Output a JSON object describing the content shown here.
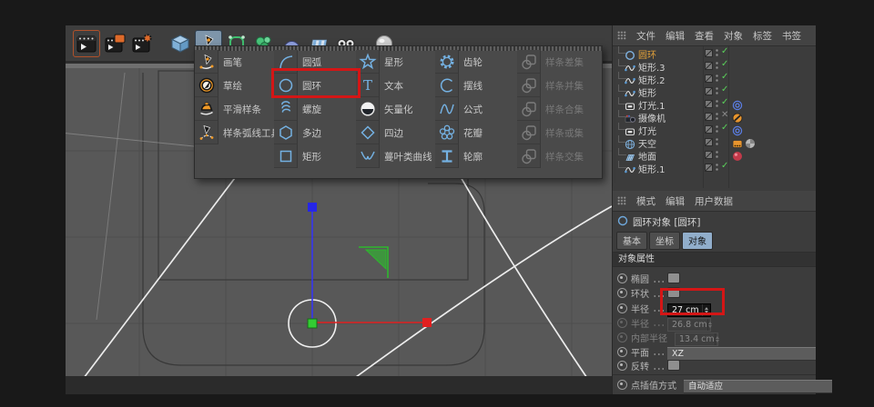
{
  "colors": {
    "annotation": "#d41616",
    "popup_icon_blue": "#74b1e2",
    "check_green": "#5ad05a",
    "selected_object_text": "#e2a13a",
    "tab_active_bg": "#91aecb",
    "axis_red": "#e02020",
    "axis_blue": "#3535f0",
    "plane_handle_green": "#2db82d"
  },
  "toolbar": {
    "buttons": [
      {
        "icon": "render-view",
        "active": true
      },
      {
        "icon": "render-picture-viewer",
        "active": false
      },
      {
        "icon": "render-settings",
        "active": false
      },
      {
        "icon": "primitive-cube",
        "active": false
      },
      {
        "icon": "spline-pen",
        "active": true
      },
      {
        "icon": "subdivision-surface",
        "active": false
      },
      {
        "icon": "modeling",
        "active": false
      },
      {
        "icon": "volume",
        "active": false
      },
      {
        "icon": "field",
        "active": false
      },
      {
        "icon": "mograph",
        "active": false
      },
      {
        "icon": "material-sphere",
        "active": false
      }
    ]
  },
  "spline_menu": {
    "tools": [
      {
        "label": "画笔",
        "icon": "tool-pen"
      },
      {
        "label": "草绘",
        "icon": "tool-sketch"
      },
      {
        "label": "平滑样条",
        "icon": "tool-smooth"
      },
      {
        "label": "样条弧线工具",
        "icon": "tool-spline-arc"
      }
    ],
    "columns": [
      {
        "items": [
          {
            "label": "圆弧",
            "icon": "arc"
          },
          {
            "label": "圆环",
            "icon": "circle",
            "highlighted": true
          },
          {
            "label": "螺旋",
            "icon": "helix"
          },
          {
            "label": "多边",
            "icon": "ngon"
          },
          {
            "label": "矩形",
            "icon": "rectangle"
          }
        ]
      },
      {
        "items": [
          {
            "label": "星形",
            "icon": "star"
          },
          {
            "label": "文本",
            "icon": "text"
          },
          {
            "label": "矢量化",
            "icon": "vectorizer"
          },
          {
            "label": "四边",
            "icon": "foursided"
          },
          {
            "label": "蔓叶类曲线",
            "icon": "cissoid"
          }
        ]
      },
      {
        "items": [
          {
            "label": "齿轮",
            "icon": "gear"
          },
          {
            "label": "摆线",
            "icon": "cycloid"
          },
          {
            "label": "公式",
            "icon": "formula"
          },
          {
            "label": "花瓣",
            "icon": "flower"
          },
          {
            "label": "轮廓",
            "icon": "profile"
          }
        ]
      },
      {
        "items": [
          {
            "label": "样条差集",
            "icon": "spline-difference",
            "disabled": true
          },
          {
            "label": "样条并集",
            "icon": "spline-union",
            "disabled": true
          },
          {
            "label": "样条合集",
            "icon": "spline-and",
            "disabled": true
          },
          {
            "label": "样条或集",
            "icon": "spline-or",
            "disabled": true
          },
          {
            "label": "样条交集",
            "icon": "spline-intersect",
            "disabled": true
          }
        ]
      }
    ]
  },
  "object_manager": {
    "menu": [
      "文件",
      "编辑",
      "查看",
      "对象",
      "标签",
      "书签"
    ],
    "objects": [
      {
        "name": "圆环",
        "icon": "circle-spline",
        "selected": true,
        "state": "check",
        "tags": []
      },
      {
        "name": "矩形.3",
        "icon": "spline",
        "selected": false,
        "state": "check",
        "tags": []
      },
      {
        "name": "矩形.2",
        "icon": "spline",
        "selected": false,
        "state": "check",
        "tags": []
      },
      {
        "name": "矩形",
        "icon": "spline",
        "selected": false,
        "state": "check",
        "tags": []
      },
      {
        "name": "灯光.1",
        "icon": "light",
        "selected": false,
        "state": "check",
        "tags": [
          "target"
        ]
      },
      {
        "name": "摄像机",
        "icon": "camera",
        "selected": false,
        "state": "cross",
        "tags": [
          "protection"
        ]
      },
      {
        "name": "灯光",
        "icon": "light",
        "selected": false,
        "state": "check",
        "tags": [
          "target"
        ]
      },
      {
        "name": "天空",
        "icon": "sky",
        "selected": false,
        "state": "none",
        "tags": [
          "compositing",
          "texture"
        ]
      },
      {
        "name": "地面",
        "icon": "floor",
        "selected": false,
        "state": "none",
        "tags": [
          "material"
        ]
      },
      {
        "name": "矩形.1",
        "icon": "spline",
        "selected": false,
        "state": "check",
        "tags": []
      }
    ]
  },
  "attribute_manager": {
    "menu": [
      "模式",
      "编辑",
      "用户数据"
    ],
    "object_icon": "circle-spline",
    "title": "圆环对象 [圆环]",
    "tabs": [
      {
        "label": "基本",
        "active": false
      },
      {
        "label": "坐标",
        "active": false
      },
      {
        "label": "对象",
        "active": true
      }
    ],
    "section": "对象属性",
    "rows": [
      {
        "label": "椭圆",
        "type": "checkbox",
        "checked": false
      },
      {
        "label": "环状",
        "type": "checkbox",
        "checked": false
      },
      {
        "label": "半径",
        "type": "input",
        "value": "27 cm",
        "highlighted": true
      },
      {
        "label": "半径",
        "type": "input",
        "value": "26.8 cm",
        "disabled": true
      },
      {
        "label": "内部半径",
        "type": "input",
        "value": "13.4 cm",
        "disabled": true
      },
      {
        "label": "平面",
        "type": "select",
        "value": "XZ"
      },
      {
        "label": "反转",
        "type": "checkbox",
        "checked": false
      },
      {
        "label": "点插值方式",
        "type": "select",
        "value": "自动适应",
        "separated": true
      }
    ]
  }
}
